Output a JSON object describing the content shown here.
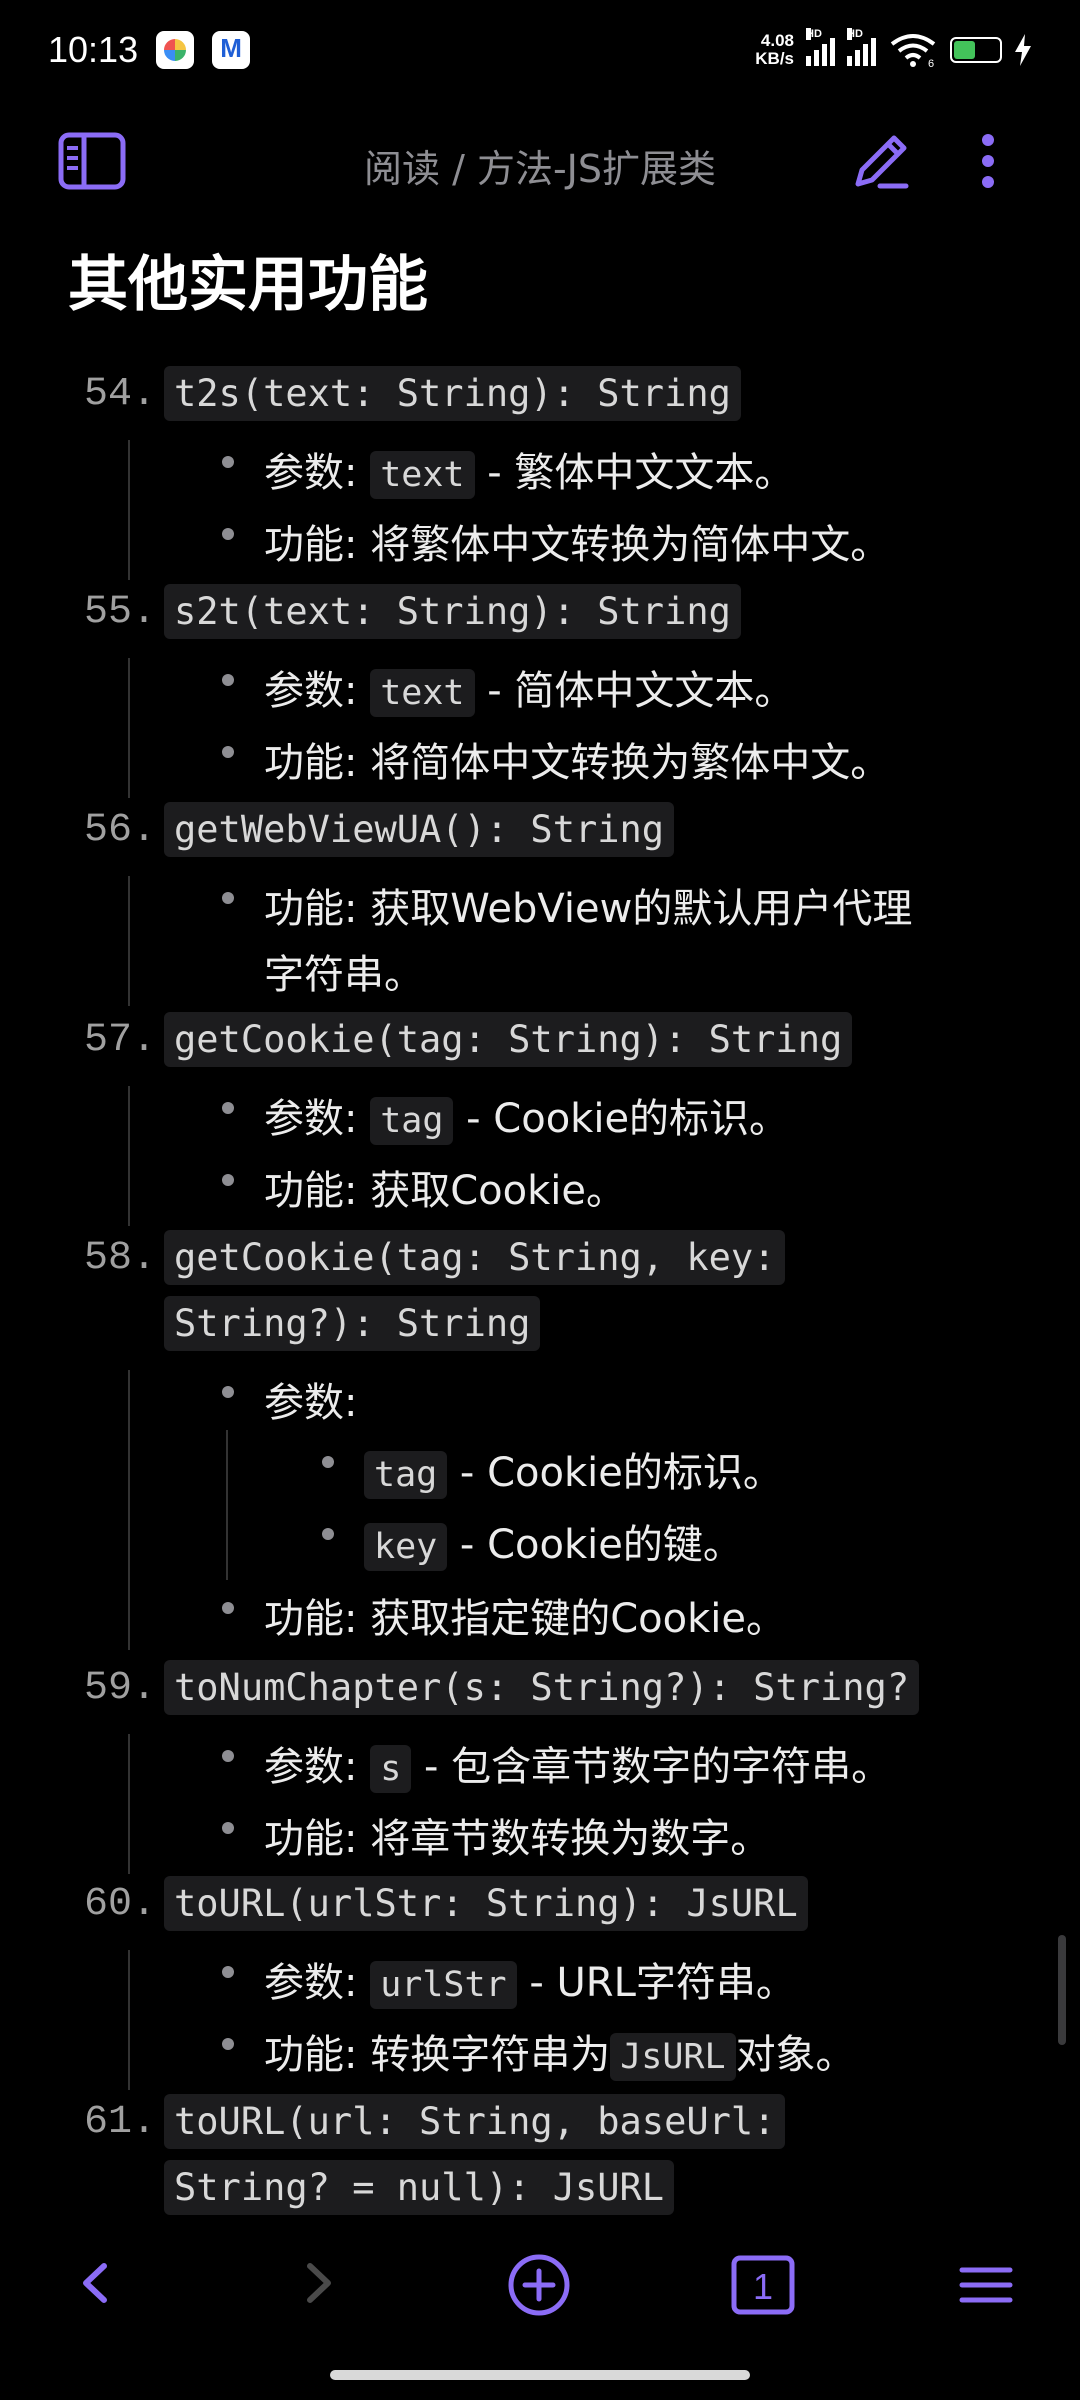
{
  "status_bar": {
    "time": "10:13",
    "net_speed": "4.08",
    "net_unit": "KB/s",
    "hd1": "HD",
    "hd2": "HD",
    "wifi_sub": "6",
    "battery": "43"
  },
  "header": {
    "title": "阅读 / 方法-JS扩展类"
  },
  "section": {
    "heading": "其他实用功能"
  },
  "labels": {
    "param": "参数:",
    "func": "功能:"
  },
  "items": [
    {
      "num": "54.",
      "sig": "t2s(text: String): String",
      "param_code": "text",
      "param_desc": " - 繁体中文文本。",
      "func": "将繁体中文转换为简体中文。"
    },
    {
      "num": "55.",
      "sig": "s2t(text: String): String",
      "param_code": "text",
      "param_desc": " - 简体中文文本。",
      "func": "将简体中文转换为繁体中文。"
    },
    {
      "num": "56.",
      "sig": "getWebViewUA(): String",
      "func_line1": "获取WebView的默认用户代理",
      "func_line2": "字符串。"
    },
    {
      "num": "57.",
      "sig": "getCookie(tag: String): String",
      "param_code": "tag",
      "param_desc": " - Cookie的标识。",
      "func": "获取Cookie。"
    },
    {
      "num": "58.",
      "sig_line1": "getCookie(tag: String, key:",
      "sig_line2": "String?): String",
      "sub": [
        {
          "code": "tag",
          "desc": " - Cookie的标识。"
        },
        {
          "code": "key",
          "desc": " - Cookie的键。"
        }
      ],
      "func": "获取指定键的Cookie。"
    },
    {
      "num": "59.",
      "sig": "toNumChapter(s: String?): String?",
      "param_code": "s",
      "param_desc": " - 包含章节数字的字符串。",
      "func": "将章节数转换为数字。"
    },
    {
      "num": "60.",
      "sig": "toURL(urlStr: String): JsURL",
      "param_code": "urlStr",
      "param_desc": " - URL字符串。",
      "func_pre": "转换字符串为",
      "func_code": "JsURL",
      "func_post": "对象。"
    },
    {
      "num": "61.",
      "sig_line1": "toURL(url: String, baseUrl:",
      "sig_line2": "String? = null): JsURL"
    }
  ],
  "bottom_nav": {
    "tab_count": "1"
  },
  "colors": {
    "accent": "#8b6cf6",
    "background": "#000000",
    "code_bg": "#1c1c1e"
  },
  "icons": [
    "sidebar-toggle-icon",
    "edit-pencil-icon",
    "more-vertical-icon",
    "back-arrow-icon",
    "forward-arrow-icon",
    "add-circle-icon",
    "tab-count-icon",
    "menu-icon"
  ]
}
